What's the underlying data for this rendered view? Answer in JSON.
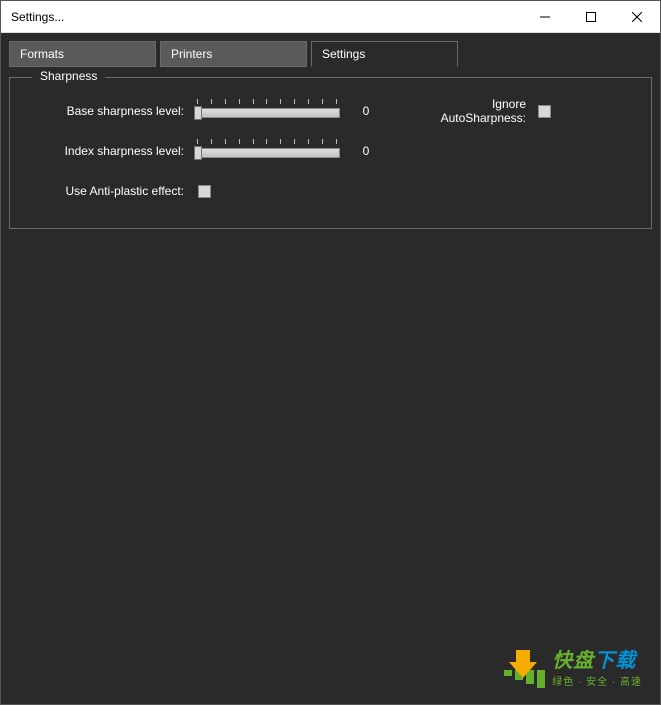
{
  "window": {
    "title": "Settings..."
  },
  "tabs": {
    "formats": "Formats",
    "printers": "Printers",
    "settings": "Settings"
  },
  "group": {
    "title": "Sharpness",
    "base_label": "Base sharpness level:",
    "base_value": "0",
    "index_label": "Index sharpness level:",
    "index_value": "0",
    "antiplastic_label": "Use Anti-plastic effect:",
    "ignore_label": "Ignore AutoSharpness:"
  },
  "watermark": {
    "main": "快盘下载",
    "sub": "绿色 · 安全 · 高速"
  }
}
